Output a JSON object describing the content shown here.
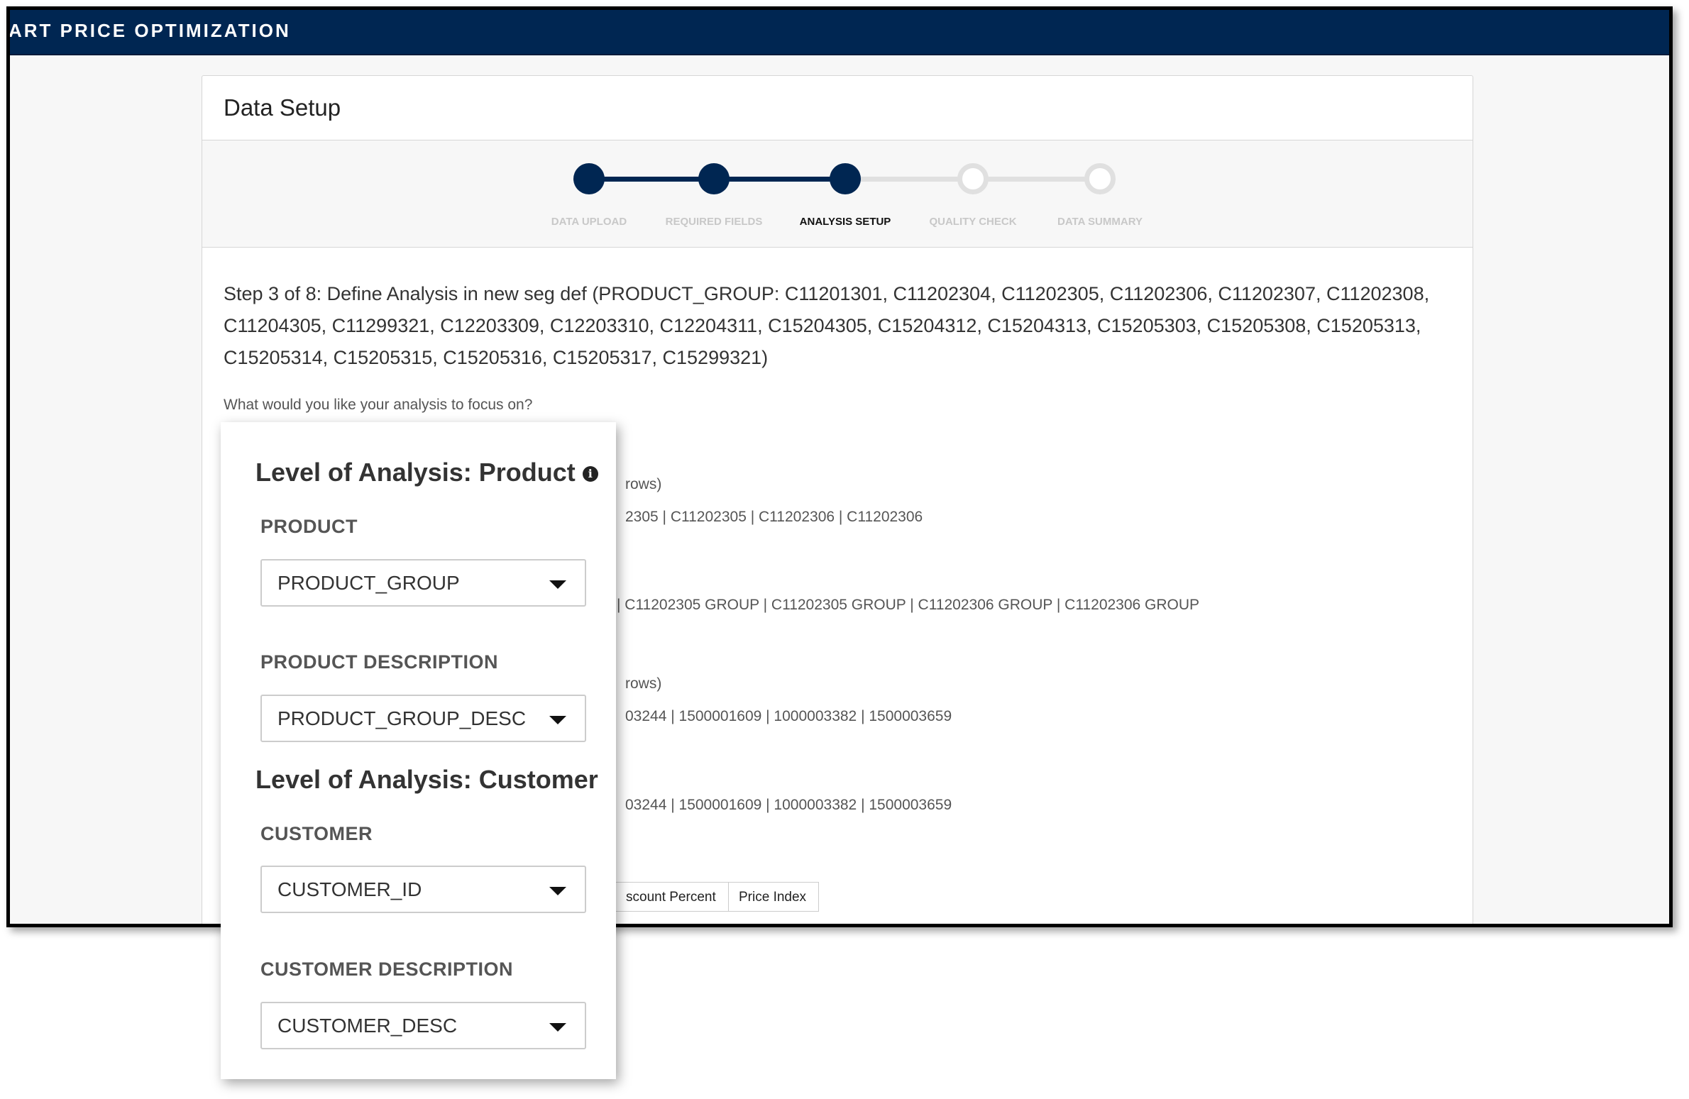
{
  "app": {
    "title": "ART PRICE OPTIMIZATION",
    "brand_color": "#002652"
  },
  "card": {
    "title": "Data Setup"
  },
  "stepper": {
    "steps": [
      {
        "label": "DATA UPLOAD",
        "state": "done"
      },
      {
        "label": "REQUIRED FIELDS",
        "state": "done"
      },
      {
        "label": "ANALYSIS SETUP",
        "state": "active"
      },
      {
        "label": "QUALITY CHECK",
        "state": "todo"
      },
      {
        "label": "DATA SUMMARY",
        "state": "todo"
      }
    ]
  },
  "main": {
    "step_text": "Step 3 of 8: Define Analysis in new seg def (PRODUCT_GROUP: C11201301, C11202304, C11202305, C11202306, C11202307, C11202308, C11204305, C11299321, C12203309, C12203310, C12204311, C15204305, C15204312, C15204313, C15205303, C15205308, C15205313, C15205314, C15205315, C15205316, C15205317, C15299321)",
    "question": "What would you like your analysis to focus on?",
    "fragments": [
      "rows)",
      "2305 | C11202305 | C11202306 | C11202306",
      "| C11202305 GROUP | C11202305 GROUP | C11202306 GROUP | C11202306 GROUP",
      "rows)",
      "03244 | 1500001609 | 1000003382 | 1500003659",
      "03244 | 1500001609 | 1000003382 | 1500003659"
    ],
    "buttons": [
      "scount Percent",
      "Price Index"
    ]
  },
  "popup": {
    "product_heading": "Level of Analysis: Product",
    "product_label": "PRODUCT",
    "product_value": "PRODUCT_GROUP",
    "product_desc_label": "PRODUCT DESCRIPTION",
    "product_desc_value": "PRODUCT_GROUP_DESC",
    "customer_heading": "Level of Analysis: Customer",
    "customer_label": "CUSTOMER",
    "customer_value": "CUSTOMER_ID",
    "customer_desc_label": "CUSTOMER DESCRIPTION",
    "customer_desc_value": "CUSTOMER_DESC",
    "info_icon": "info-circle-icon"
  }
}
